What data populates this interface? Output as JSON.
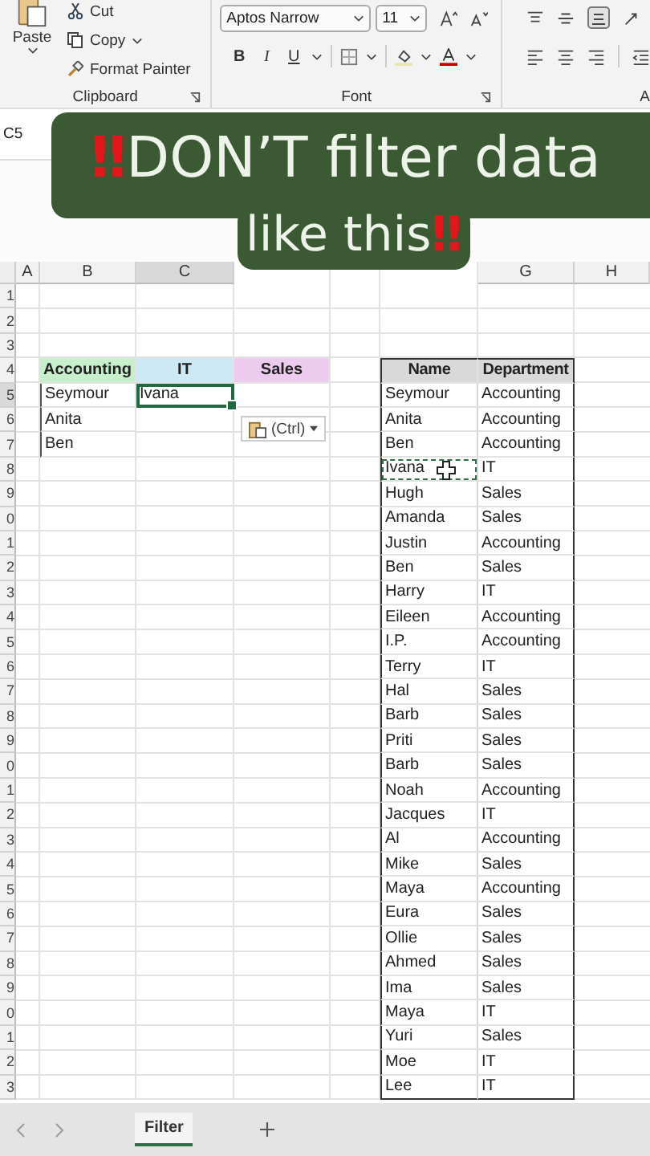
{
  "ribbon": {
    "clipboard": {
      "paste": "Paste",
      "cut": "Cut",
      "copy": "Copy",
      "format_painter": "Format Painter",
      "group": "Clipboard"
    },
    "font": {
      "font_name": "Aptos Narrow",
      "font_size": "11",
      "bold": "B",
      "italic": "I",
      "underline": "U",
      "group": "Font"
    },
    "alignment": {
      "group": "A"
    }
  },
  "name_box": "C5",
  "caption": {
    "lines": [
      [
        {
          "kind": "emoji",
          "text": "‼"
        },
        {
          "kind": "text",
          "text": "DON’T filter data"
        }
      ],
      [
        {
          "kind": "text",
          "text": "like this"
        },
        {
          "kind": "emoji",
          "text": "‼"
        }
      ]
    ]
  },
  "column_headers": [
    "A",
    "B",
    "C",
    "G",
    "H"
  ],
  "row_headers": [
    "1",
    "2",
    "3",
    "4",
    "5",
    "6",
    "7",
    "8",
    "9",
    "0",
    "1",
    "2",
    "3",
    "4",
    "5",
    "6",
    "7",
    "8",
    "9",
    "0",
    "1",
    "2",
    "3",
    "4",
    "5",
    "6",
    "7",
    "8",
    "9",
    "0",
    "1",
    "2",
    "3"
  ],
  "department_table": {
    "departments": [
      {
        "label": "Accounting",
        "color": "#c8efcc",
        "names": [
          {
            "text": "Seymour",
            "selected": false
          },
          {
            "text": "Anita",
            "selected": false
          },
          {
            "text": "Ben",
            "selected": false
          }
        ]
      },
      {
        "label": "IT",
        "color": "#cde9f6",
        "names": [
          {
            "text": "Ivana",
            "selected": true
          }
        ]
      },
      {
        "label": "Sales",
        "color": "#eccbee"
      }
    ]
  },
  "paste_options": {
    "label": "(Ctrl)"
  },
  "staff_table": {
    "columns": [
      "Name",
      "Department"
    ],
    "rows": [
      {
        "name": "Seymour",
        "department": "Accounting",
        "copied": false
      },
      {
        "name": "Anita",
        "department": "Accounting",
        "copied": false
      },
      {
        "name": "Ben",
        "department": "Accounting",
        "copied": false
      },
      {
        "name": "Ivana",
        "department": "IT",
        "copied": true
      },
      {
        "name": "Hugh",
        "department": "Sales",
        "copied": false
      },
      {
        "name": "Amanda",
        "department": "Sales",
        "copied": false
      },
      {
        "name": "Justin",
        "department": "Accounting",
        "copied": false
      },
      {
        "name": "Ben",
        "department": "Sales",
        "copied": false
      },
      {
        "name": "Harry",
        "department": "IT",
        "copied": false
      },
      {
        "name": "Eileen",
        "department": "Accounting",
        "copied": false
      },
      {
        "name": "I.P.",
        "department": "Accounting",
        "copied": false
      },
      {
        "name": "Terry",
        "department": "IT",
        "copied": false
      },
      {
        "name": "Hal",
        "department": "Sales",
        "copied": false
      },
      {
        "name": "Barb",
        "department": "Sales",
        "copied": false
      },
      {
        "name": "Priti",
        "department": "Sales",
        "copied": false
      },
      {
        "name": "Barb",
        "department": "Sales",
        "copied": false
      },
      {
        "name": "Noah",
        "department": "Accounting",
        "copied": false
      },
      {
        "name": "Jacques",
        "department": "IT",
        "copied": false
      },
      {
        "name": "Al",
        "department": "Accounting",
        "copied": false
      },
      {
        "name": "Mike",
        "department": "Sales",
        "copied": false
      },
      {
        "name": "Maya",
        "department": "Accounting",
        "copied": false
      },
      {
        "name": "Eura",
        "department": "Sales",
        "copied": false
      },
      {
        "name": "Ollie",
        "department": "Sales",
        "copied": false
      },
      {
        "name": "Ahmed",
        "department": "Sales",
        "copied": false
      },
      {
        "name": "Ima",
        "department": "Sales",
        "copied": false
      },
      {
        "name": "Maya",
        "department": "IT",
        "copied": false
      },
      {
        "name": "Yuri",
        "department": "Sales",
        "copied": false
      },
      {
        "name": "Moe",
        "department": "IT",
        "copied": false
      },
      {
        "name": "Lee",
        "department": "IT",
        "copied": false
      }
    ]
  },
  "sheet_tabs": [
    {
      "label": "Filter",
      "selected": true
    }
  ]
}
